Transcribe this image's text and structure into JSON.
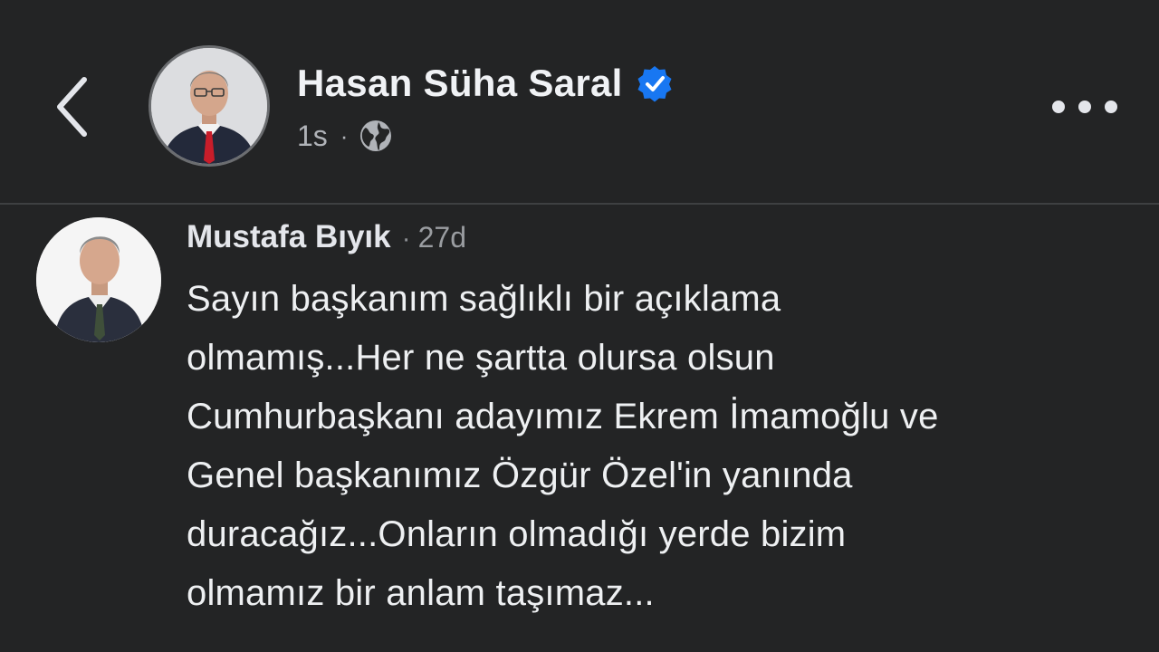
{
  "header": {
    "author_name": "Hasan Süha Saral",
    "post_time": "1s",
    "separator": "·",
    "verified": true,
    "audience_icon": "globe-icon",
    "back_icon": "chevron-left-icon",
    "more_icon": "more-horizontal-icon"
  },
  "comment": {
    "author": "Mustafa Bıyık",
    "separator": "·",
    "time": "27d",
    "lines": [
      "Sayın başkanım sağlıklı bir açıklama",
      "olmamış...Her ne şartta olursa olsun",
      "Cumhurbaşkanı adayımız Ekrem İmamoğlu ve",
      "Genel başkanımız Özgür Özel'in yanında",
      "duracağız...Onların olmadığı yerde bizim",
      "olmamız bir anlam taşımaz..."
    ]
  },
  "colors": {
    "background": "#232425",
    "text_primary": "#e4e6eb",
    "text_secondary": "#b0b3b8",
    "verified_badge": "#1877f2",
    "divider": "#3e4042"
  }
}
